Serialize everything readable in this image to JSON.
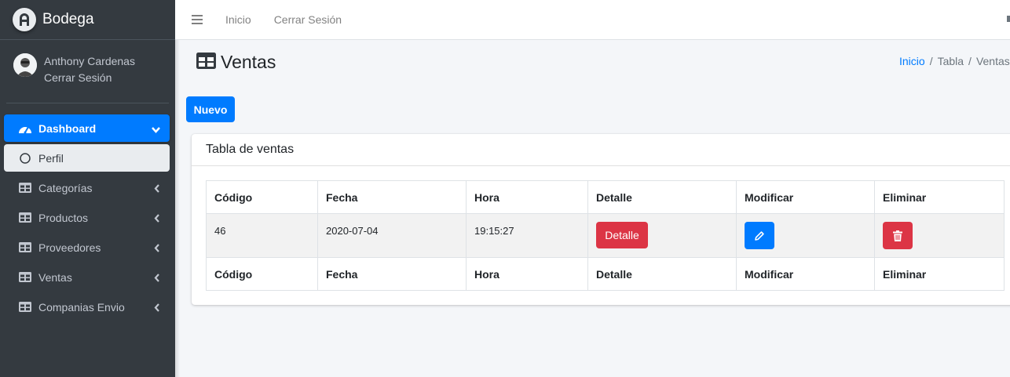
{
  "brand": {
    "name": "Bodega"
  },
  "user": {
    "name": "Anthony Cardenas",
    "logout": "Cerrar Sesión"
  },
  "sidebar": {
    "items": [
      {
        "label": "Dashboard",
        "icon": "tachometer-icon"
      },
      {
        "label": "Perfil",
        "icon": "circle-icon"
      },
      {
        "label": "Categorías",
        "icon": "table-icon"
      },
      {
        "label": "Productos",
        "icon": "table-icon"
      },
      {
        "label": "Proveedores",
        "icon": "table-icon"
      },
      {
        "label": "Ventas",
        "icon": "table-icon"
      },
      {
        "label": "Companias Envio",
        "icon": "table-icon"
      }
    ]
  },
  "topbar": {
    "links": [
      "Inicio",
      "Cerrar Sesión"
    ]
  },
  "page": {
    "title": "Ventas",
    "new_button": "Nuevo"
  },
  "breadcrumb": {
    "items": [
      "Inicio",
      "Tabla",
      "Ventas"
    ]
  },
  "card": {
    "title": "Tabla de ventas",
    "columns": [
      "Código",
      "Fecha",
      "Hora",
      "Detalle",
      "Modificar",
      "Eliminar"
    ],
    "rows": [
      {
        "codigo": "46",
        "fecha": "2020-07-04",
        "hora": "19:15:27",
        "detalle_label": "Detalle"
      }
    ]
  },
  "colors": {
    "primary": "#007bff",
    "danger": "#dc3545",
    "sidebar": "#343a40"
  }
}
